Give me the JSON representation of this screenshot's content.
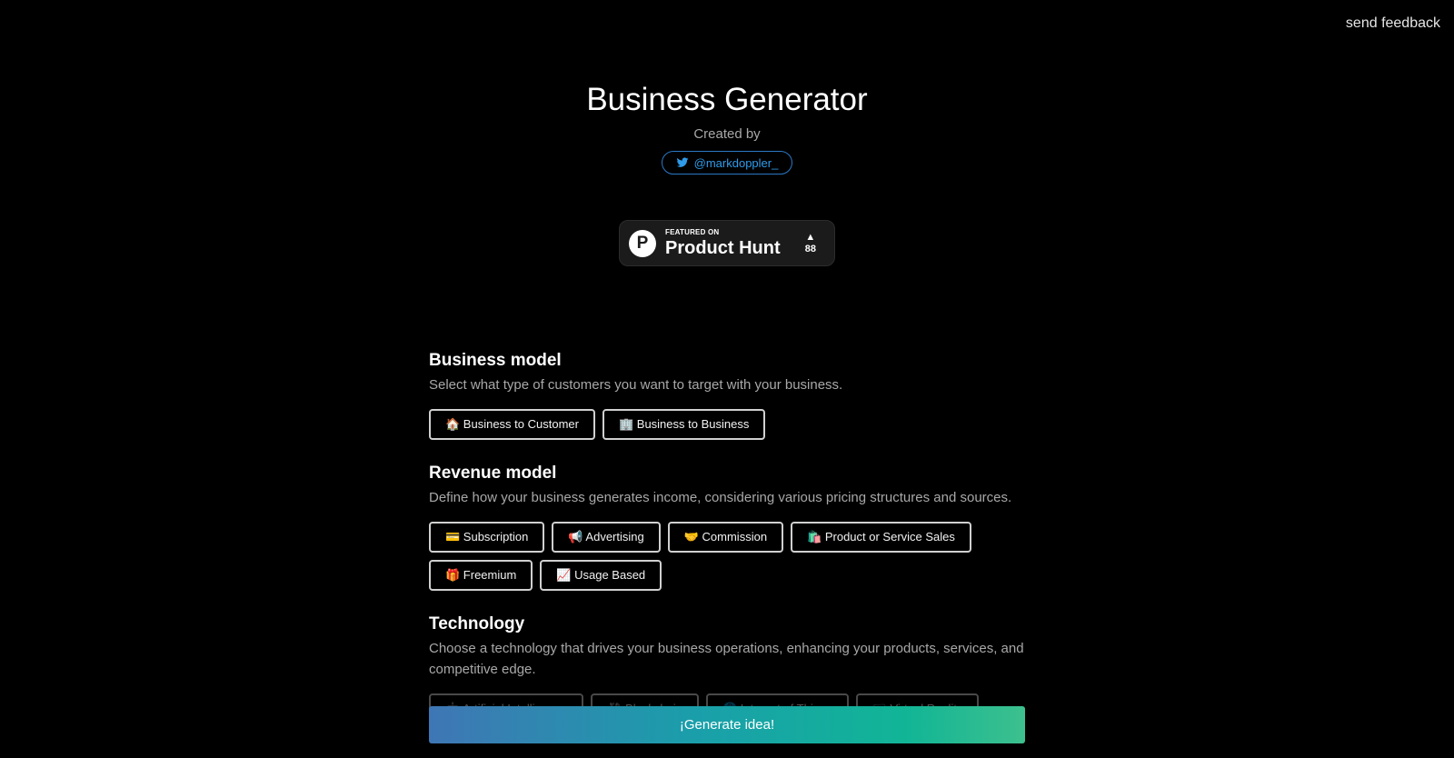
{
  "header": {
    "feedback_label": "send feedback"
  },
  "hero": {
    "title": "Business Generator",
    "created_by": "Created by",
    "twitter_handle": "@markdoppler_",
    "twitter_color": "#2f9be9"
  },
  "product_hunt": {
    "logo_letter": "P",
    "featured_label": "FEATURED ON",
    "name": "Product Hunt",
    "votes": "88"
  },
  "sections": {
    "business_model": {
      "title": "Business model",
      "description": "Select what type of customers you want to target with your business.",
      "options": [
        "🏠 Business to Customer",
        "🏢 Business to Business"
      ]
    },
    "revenue_model": {
      "title": "Revenue model",
      "description": "Define how your business generates income, considering various pricing structures and sources.",
      "options": [
        "💳 Subscription",
        "📢 Advertising",
        "🤝 Commission",
        "🛍️ Product or Service Sales",
        "🎁 Freemium",
        "📈 Usage Based"
      ]
    },
    "technology": {
      "title": "Technology",
      "description": "Choose a technology that drives your business operations, enhancing your products, services, and competitive edge.",
      "options": [
        "🤖 Artificial Intelligence",
        "⛓ Blockchain",
        "🌐 Internet of Things",
        "🥽 Virtual Reality"
      ]
    }
  },
  "generate_label": "¡Generate idea!"
}
